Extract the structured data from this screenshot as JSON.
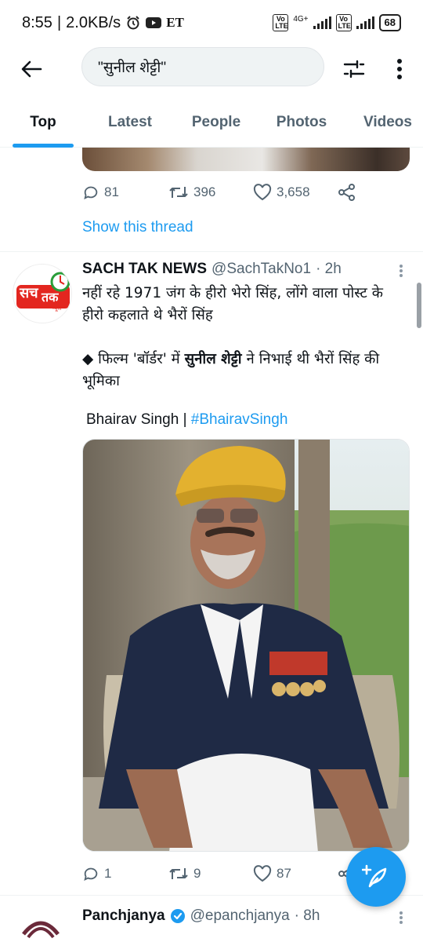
{
  "status_bar": {
    "time": "8:55",
    "speed": "2.0KB/s",
    "et_label": "ET",
    "volte_1": "Vo LTE",
    "network": "4G+",
    "volte_2": "Vo LTE",
    "battery": "68"
  },
  "header": {
    "search_query": "\"सुनील शेट्टी\""
  },
  "tabs": [
    {
      "label": "Top",
      "active": true
    },
    {
      "label": "Latest"
    },
    {
      "label": "People"
    },
    {
      "label": "Photos"
    },
    {
      "label": "Videos"
    }
  ],
  "prev_tweet": {
    "replies": "81",
    "retweets": "396",
    "likes": "3,658",
    "show_thread": "Show this thread"
  },
  "tweet": {
    "avatar_text_1": "सच",
    "avatar_text_2": "तक",
    "avatar_text_3": "न्यूज",
    "name": "SACH TAK NEWS",
    "handle": "@SachTakNo1",
    "time": "· 2h",
    "text_line1": "नहीं रहे 1971 जंग के हीरो भेरो सिंह, लोंगे वाला पोस्ट के हीरो कहलाते थे भैरों सिंह",
    "text_line2_prefix": "◆ फिल्म 'बॉर्डर' में ",
    "text_line2_bold": "सुनील शेट्टी",
    "text_line2_suffix": " ने निभाई थी भैरों सिंह की भूमिका",
    "caption_text": "Bhairav Singh | ",
    "caption_hashtag": "#BhairavSingh",
    "replies": "1",
    "retweets": "9",
    "likes": "87"
  },
  "next_tweet": {
    "name": "Panchjanya",
    "handle": "@epanchjanya",
    "time": "· 8h"
  },
  "colors": {
    "accent": "#1d9bf0",
    "text_primary": "#0f1419",
    "text_secondary": "#536471"
  }
}
